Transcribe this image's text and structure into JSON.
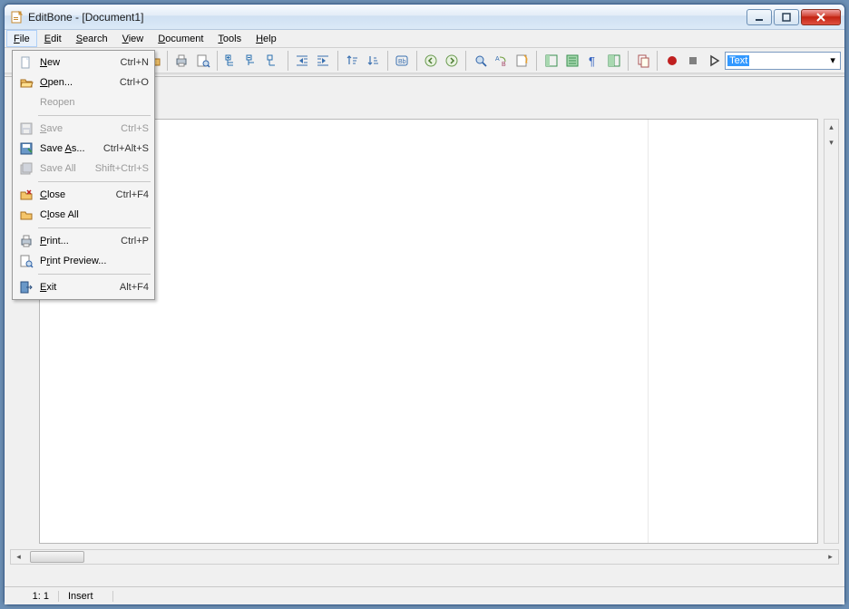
{
  "window": {
    "title": "EditBone - [Document1]"
  },
  "menubar": {
    "items": [
      "File",
      "Edit",
      "Search",
      "View",
      "Document",
      "Tools",
      "Help"
    ],
    "active_index": 0
  },
  "highlighter_dropdown": {
    "value": "Text"
  },
  "file_menu": {
    "groups": [
      [
        {
          "label": "New",
          "shortcut": "Ctrl+N",
          "icon": "new-file-icon",
          "disabled": false
        },
        {
          "label": "Open...",
          "shortcut": "Ctrl+O",
          "icon": "open-folder-icon",
          "disabled": false
        },
        {
          "label": "Reopen",
          "shortcut": "",
          "icon": "",
          "disabled": true
        }
      ],
      [
        {
          "label": "Save",
          "shortcut": "Ctrl+S",
          "icon": "save-icon",
          "disabled": true
        },
        {
          "label": "Save As...",
          "shortcut": "Ctrl+Alt+S",
          "icon": "save-as-icon",
          "disabled": false
        },
        {
          "label": "Save All",
          "shortcut": "Shift+Ctrl+S",
          "icon": "save-all-icon",
          "disabled": true
        }
      ],
      [
        {
          "label": "Close",
          "shortcut": "Ctrl+F4",
          "icon": "close-doc-icon",
          "disabled": false
        },
        {
          "label": "Close All",
          "shortcut": "",
          "icon": "close-all-icon",
          "disabled": false
        }
      ],
      [
        {
          "label": "Print...",
          "shortcut": "Ctrl+P",
          "icon": "print-icon",
          "disabled": false
        },
        {
          "label": "Print Preview...",
          "shortcut": "",
          "icon": "print-preview-icon",
          "disabled": false
        }
      ],
      [
        {
          "label": "Exit",
          "shortcut": "Alt+F4",
          "icon": "exit-icon",
          "disabled": false
        }
      ]
    ]
  },
  "toolbar": {
    "sections": [
      [
        "open-folder-icon"
      ],
      [
        "print-icon",
        "print-preview-icon"
      ],
      [
        "tree-expand-icon",
        "tree-collapse-icon",
        "tree-toggle-icon"
      ],
      [
        "indent-decrease-icon",
        "indent-increase-icon"
      ],
      [
        "sort-asc-icon",
        "sort-desc-icon"
      ],
      [
        "selection-box-icon"
      ],
      [
        "nav-back-icon",
        "nav-forward-icon"
      ],
      [
        "find-icon",
        "find-replace-icon",
        "refresh-icon"
      ],
      [
        "panel-a-icon",
        "panel-b-icon",
        "pilcrow-icon",
        "panel-split-icon"
      ],
      [
        "copy-doc-icon"
      ],
      [
        "record-icon",
        "stop-icon",
        "play-icon"
      ]
    ]
  },
  "statusbar": {
    "position": "1: 1",
    "mode": "Insert"
  }
}
